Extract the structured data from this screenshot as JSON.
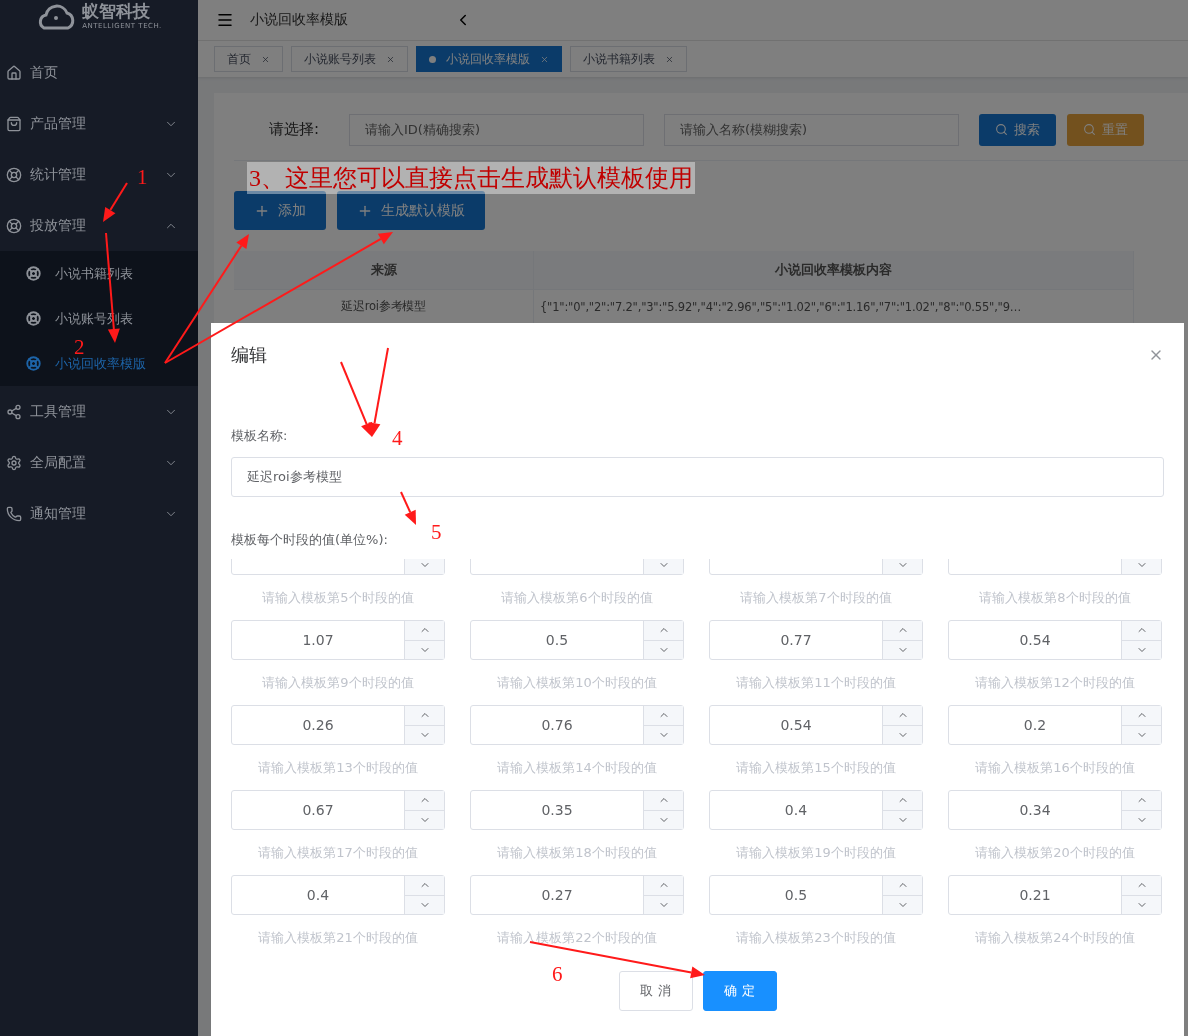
{
  "logo": {
    "name": "蚁智科技",
    "tagline": "ANTELLIGENT TECH."
  },
  "sidebar": {
    "items": [
      {
        "label": "首页"
      },
      {
        "label": "产品管理",
        "expanded": false
      },
      {
        "label": "统计管理",
        "expanded": false
      },
      {
        "label": "投放管理",
        "expanded": true,
        "children": [
          {
            "label": "小说书籍列表",
            "selected": false
          },
          {
            "label": "小说账号列表",
            "selected": false
          },
          {
            "label": "小说回收率模版",
            "selected": true
          }
        ]
      },
      {
        "label": "工具管理",
        "expanded": false
      },
      {
        "label": "全局配置",
        "expanded": false
      },
      {
        "label": "通知管理",
        "expanded": false
      }
    ]
  },
  "header": {
    "title": "小说回收率模版"
  },
  "tabs": [
    {
      "label": "首页",
      "selected": false
    },
    {
      "label": "小说账号列表",
      "selected": false
    },
    {
      "label": "小说回收率模版",
      "selected": true
    },
    {
      "label": "小说书籍列表",
      "selected": false
    }
  ],
  "search": {
    "label": "请选择:",
    "fields": [
      {
        "placeholder": "请输入ID(精确搜索)"
      },
      {
        "placeholder": "请输入名称(模糊搜索)"
      }
    ],
    "buttons": [
      {
        "label": "搜索",
        "kind": "primary"
      },
      {
        "label": "重置",
        "kind": "warning"
      }
    ]
  },
  "actions": [
    {
      "label": "添加"
    },
    {
      "label": "生成默认模版"
    }
  ],
  "table": {
    "columns": [
      "来源",
      "小说回收率模板内容"
    ],
    "rows": [
      [
        "延迟roi参考模型",
        "{\"1\":\"0\",\"2\":\"7.2\",\"3\":\"5.92\",\"4\":\"2.96\",\"5\":\"1.02\",\"6\":\"1.16\",\"7\":\"1.02\",\"8\":\"0.55\",\"9…"
      ]
    ]
  },
  "dialog": {
    "title": "编辑",
    "name_label": "模板名称:",
    "name_value": "延迟roi参考模型",
    "values_label": "模板每个时段的值(单位%):",
    "fields": [
      {
        "hint": "请输入模板第5个时段的值"
      },
      {
        "hint": "请输入模板第6个时段的值"
      },
      {
        "hint": "请输入模板第7个时段的值"
      },
      {
        "hint": "请输入模板第8个时段的值"
      },
      {
        "value": "1.07",
        "hint": "请输入模板第9个时段的值"
      },
      {
        "value": "0.5",
        "hint": "请输入模板第10个时段的值"
      },
      {
        "value": "0.77",
        "hint": "请输入模板第11个时段的值"
      },
      {
        "value": "0.54",
        "hint": "请输入模板第12个时段的值"
      },
      {
        "value": "0.26",
        "hint": "请输入模板第13个时段的值"
      },
      {
        "value": "0.76",
        "hint": "请输入模板第14个时段的值"
      },
      {
        "value": "0.54",
        "hint": "请输入模板第15个时段的值"
      },
      {
        "value": "0.2",
        "hint": "请输入模板第16个时段的值"
      },
      {
        "value": "0.67",
        "hint": "请输入模板第17个时段的值"
      },
      {
        "value": "0.35",
        "hint": "请输入模板第18个时段的值"
      },
      {
        "value": "0.4",
        "hint": "请输入模板第19个时段的值"
      },
      {
        "value": "0.34",
        "hint": "请输入模板第20个时段的值"
      },
      {
        "value": "0.4",
        "hint": "请输入模板第21个时段的值"
      },
      {
        "value": "0.27",
        "hint": "请输入模板第22个时段的值"
      },
      {
        "value": "0.5",
        "hint": "请输入模板第23个时段的值"
      },
      {
        "value": "0.21",
        "hint": "请输入模板第24个时段的值"
      }
    ],
    "buttons": [
      {
        "label": "取 消",
        "kind": "default"
      },
      {
        "label": "确 定",
        "kind": "primary"
      }
    ]
  },
  "annotations": {
    "note": "3、这里您可以直接点击生成默认模板使用",
    "numbers": [
      "1",
      "2",
      "4",
      "5",
      "6"
    ]
  }
}
